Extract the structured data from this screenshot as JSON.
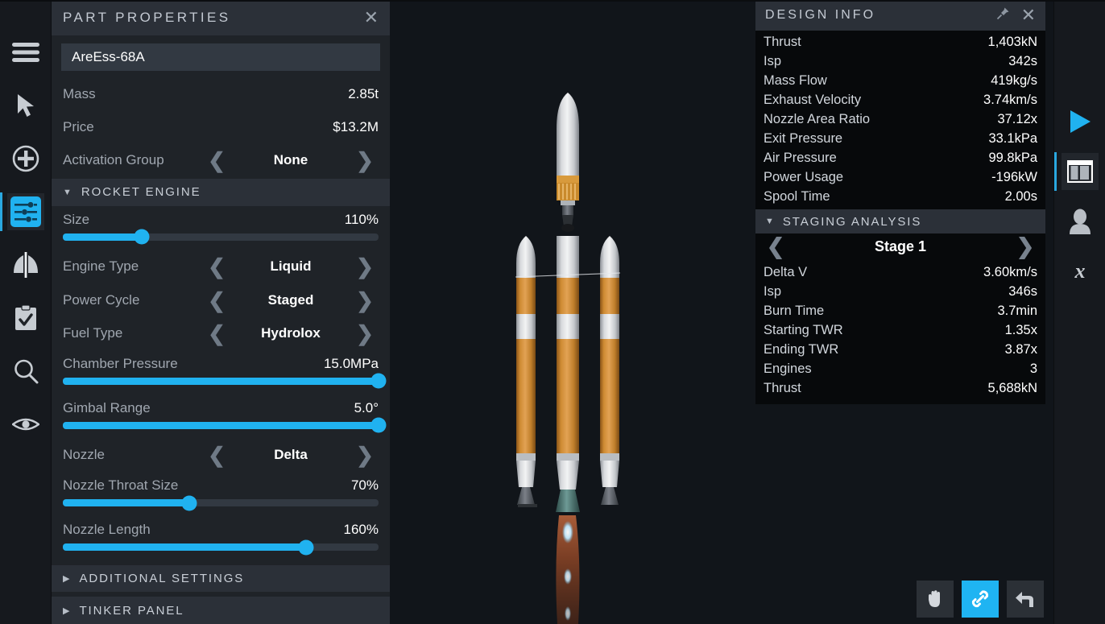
{
  "left_rail": {
    "items": [
      {
        "name": "menu-icon",
        "label": "Menu",
        "active": false
      },
      {
        "name": "cursor-icon",
        "label": "Select",
        "active": false
      },
      {
        "name": "add-part-icon",
        "label": "Add Part",
        "active": false
      },
      {
        "name": "part-properties-icon",
        "label": "Part Properties",
        "active": true
      },
      {
        "name": "symmetry-icon",
        "label": "Symmetry",
        "active": false
      },
      {
        "name": "checklist-icon",
        "label": "Checklist",
        "active": false
      },
      {
        "name": "search-icon",
        "label": "Search",
        "active": false
      },
      {
        "name": "visibility-icon",
        "label": "Visibility",
        "active": false
      }
    ]
  },
  "right_rail": {
    "items": [
      {
        "name": "launch-play-icon",
        "label": "Launch",
        "active": false
      },
      {
        "name": "panel-layout-icon",
        "label": "Design Info Panel",
        "active": true
      },
      {
        "name": "crew-icon",
        "label": "Crew",
        "active": false
      },
      {
        "name": "randomize-icon",
        "label": "Randomize",
        "active": false
      }
    ]
  },
  "part_properties": {
    "title": "PART PROPERTIES",
    "close_label": "✕",
    "part_name": "AreEss-68A",
    "part_name_placeholder": "Part name",
    "stats": [
      {
        "label": "Mass",
        "value": "2.85t"
      },
      {
        "label": "Price",
        "value": "$13.2M"
      }
    ],
    "activation_group": {
      "label": "Activation Group",
      "value": "None",
      "prev": "❮",
      "next": "❯"
    },
    "rocket_engine": {
      "title": "ROCKET ENGINE",
      "expanded_marker": "▼",
      "size": {
        "label": "Size",
        "value": "110%",
        "percent": 25
      },
      "engine_type": {
        "label": "Engine Type",
        "value": "Liquid"
      },
      "power_cycle": {
        "label": "Power Cycle",
        "value": "Staged"
      },
      "fuel_type": {
        "label": "Fuel Type",
        "value": "Hydrolox"
      },
      "chamber_pressure": {
        "label": "Chamber Pressure",
        "value": "15.0MPa",
        "percent": 100
      },
      "gimbal_range": {
        "label": "Gimbal Range",
        "value": "5.0°",
        "percent": 100
      },
      "nozzle": {
        "label": "Nozzle",
        "value": "Delta"
      },
      "nozzle_throat_size": {
        "label": "Nozzle Throat Size",
        "value": "70%",
        "percent": 40
      },
      "nozzle_length": {
        "label": "Nozzle Length",
        "value": "160%",
        "percent": 77
      }
    },
    "additional_settings": {
      "title": "ADDITIONAL SETTINGS",
      "collapsed_marker": "▶"
    },
    "tinker_panel": {
      "title": "TINKER PANEL",
      "collapsed_marker": "▶"
    }
  },
  "design_info": {
    "title": "DESIGN INFO",
    "pin_label": "pin",
    "close_label": "✕",
    "rows": [
      {
        "label": "Thrust",
        "value": "1,403kN"
      },
      {
        "label": "Isp",
        "value": "342s"
      },
      {
        "label": "Mass Flow",
        "value": "419kg/s"
      },
      {
        "label": "Exhaust Velocity",
        "value": "3.74km/s"
      },
      {
        "label": "Nozzle Area Ratio",
        "value": "37.12x"
      },
      {
        "label": "Exit Pressure",
        "value": "33.1kPa"
      },
      {
        "label": "Air Pressure",
        "value": "99.8kPa"
      },
      {
        "label": "Power Usage",
        "value": "-196kW"
      },
      {
        "label": "Spool Time",
        "value": "2.00s"
      }
    ],
    "staging_analysis": {
      "title": "STAGING ANALYSIS",
      "expanded_marker": "▼",
      "stage_label": "Stage 1",
      "prev": "❮",
      "next": "❯",
      "rows": [
        {
          "label": "Delta V",
          "value": "3.60km/s"
        },
        {
          "label": "Isp",
          "value": "346s"
        },
        {
          "label": "Burn Time",
          "value": "3.7min"
        },
        {
          "label": "Starting TWR",
          "value": "1.35x"
        },
        {
          "label": "Ending TWR",
          "value": "3.87x"
        },
        {
          "label": "Engines",
          "value": "3"
        },
        {
          "label": "Thrust",
          "value": "5,688kN"
        }
      ]
    }
  },
  "tools": {
    "items": [
      {
        "name": "pan-hand-icon",
        "label": "Pan",
        "active": false
      },
      {
        "name": "link-icon",
        "label": "Link Parts",
        "active": true
      },
      {
        "name": "undo-icon",
        "label": "Undo",
        "active": false
      }
    ]
  },
  "colors": {
    "accent": "#20b2f0",
    "panel_bg": "#1f2328",
    "header_bg": "#2b3038",
    "viewport_bg": "#11151a",
    "info_bg": "#07090b"
  }
}
